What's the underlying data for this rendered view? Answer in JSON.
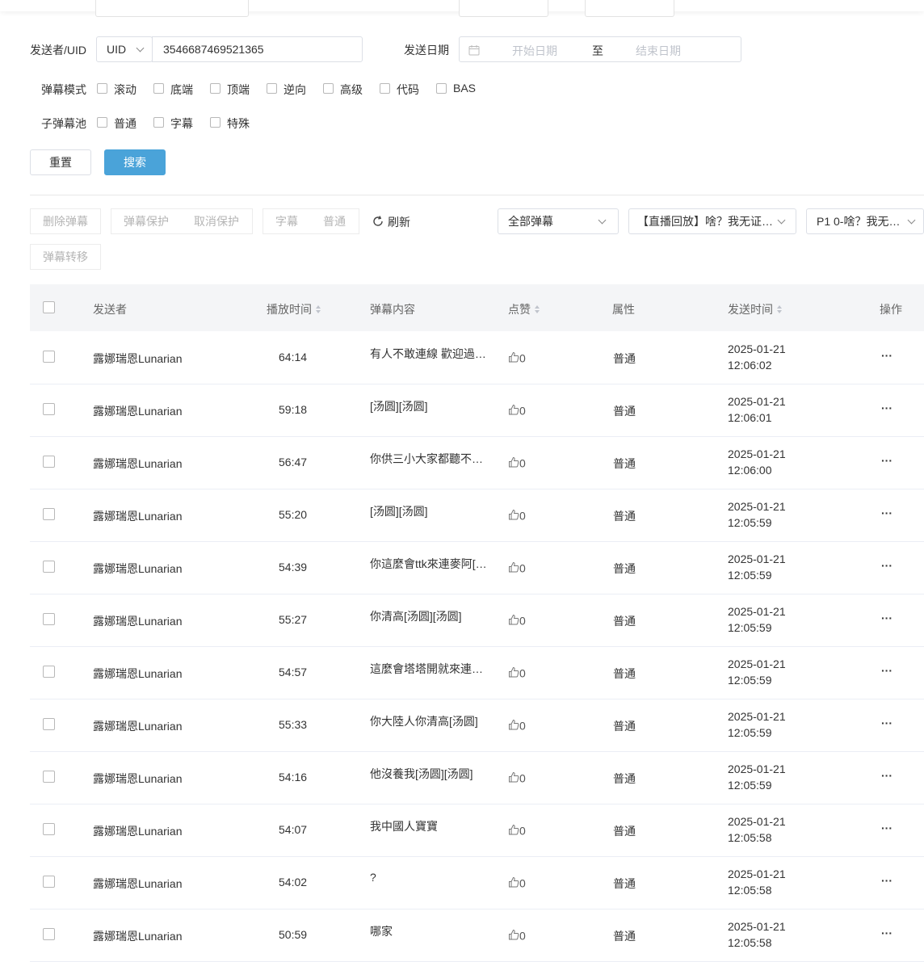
{
  "filters": {
    "sender_label": "发送者/UID",
    "sender_type": "UID",
    "uid_value": "3546687469521365",
    "date_label": "发送日期",
    "start_placeholder": "开始日期",
    "date_separator": "至",
    "end_placeholder": "结束日期",
    "mode_label": "弹幕模式",
    "modes": [
      "滚动",
      "底端",
      "顶端",
      "逆向",
      "高级",
      "代码",
      "BAS"
    ],
    "pool_label": "子弹幕池",
    "pools": [
      "普通",
      "字幕",
      "特殊"
    ],
    "reset_label": "重置",
    "search_label": "搜索"
  },
  "toolbar": {
    "delete_label": "删除弹幕",
    "protect_label": "弹幕保护",
    "unprotect_label": "取消保护",
    "subtitle_label": "字幕",
    "normal_label": "普通",
    "refresh_label": "刷新",
    "transfer_label": "弹幕转移",
    "filter_select": "全部弹幕",
    "video_select": "【直播回放】啥？我无证…",
    "part_select": "P1 0-啥？我无…"
  },
  "table": {
    "headers": {
      "sender": "发送者",
      "playtime": "播放时间",
      "content": "弹幕内容",
      "likes": "点赞",
      "attr": "属性",
      "sendtime": "发送时间",
      "action": "操作"
    },
    "rows": [
      {
        "sender": "露娜瑞恩Lunarian",
        "playtime": "64:14",
        "content": "有人不敢連線 歡迎過…",
        "likes": "0",
        "attr": "普通",
        "date": "2025-01-21",
        "time": "12:06:02"
      },
      {
        "sender": "露娜瑞恩Lunarian",
        "playtime": "59:18",
        "content": "[汤圆][汤圆]",
        "likes": "0",
        "attr": "普通",
        "date": "2025-01-21",
        "time": "12:06:01"
      },
      {
        "sender": "露娜瑞恩Lunarian",
        "playtime": "56:47",
        "content": "你供三小大家都聽不…",
        "likes": "0",
        "attr": "普通",
        "date": "2025-01-21",
        "time": "12:06:00"
      },
      {
        "sender": "露娜瑞恩Lunarian",
        "playtime": "55:20",
        "content": "[汤圆][汤圆]",
        "likes": "0",
        "attr": "普通",
        "date": "2025-01-21",
        "time": "12:05:59"
      },
      {
        "sender": "露娜瑞恩Lunarian",
        "playtime": "54:39",
        "content": "你這麼會ttk來連麥阿[…",
        "likes": "0",
        "attr": "普通",
        "date": "2025-01-21",
        "time": "12:05:59"
      },
      {
        "sender": "露娜瑞恩Lunarian",
        "playtime": "55:27",
        "content": "你清高[汤圆][汤圆]",
        "likes": "0",
        "attr": "普通",
        "date": "2025-01-21",
        "time": "12:05:59"
      },
      {
        "sender": "露娜瑞恩Lunarian",
        "playtime": "54:57",
        "content": "這麼會塔塔開就來連…",
        "likes": "0",
        "attr": "普通",
        "date": "2025-01-21",
        "time": "12:05:59"
      },
      {
        "sender": "露娜瑞恩Lunarian",
        "playtime": "55:33",
        "content": "你大陸人你清高[汤圆]",
        "likes": "0",
        "attr": "普通",
        "date": "2025-01-21",
        "time": "12:05:59"
      },
      {
        "sender": "露娜瑞恩Lunarian",
        "playtime": "54:16",
        "content": "他沒養我[汤圆][汤圆]",
        "likes": "0",
        "attr": "普通",
        "date": "2025-01-21",
        "time": "12:05:59"
      },
      {
        "sender": "露娜瑞恩Lunarian",
        "playtime": "54:07",
        "content": "我中國人寶寶",
        "likes": "0",
        "attr": "普通",
        "date": "2025-01-21",
        "time": "12:05:58"
      },
      {
        "sender": "露娜瑞恩Lunarian",
        "playtime": "54:02",
        "content": "?",
        "likes": "0",
        "attr": "普通",
        "date": "2025-01-21",
        "time": "12:05:58"
      },
      {
        "sender": "露娜瑞恩Lunarian",
        "playtime": "50:59",
        "content": "哪家",
        "likes": "0",
        "attr": "普通",
        "date": "2025-01-21",
        "time": "12:05:58"
      }
    ],
    "action_glyph": "···"
  },
  "icons": {
    "calendar": "calendar-icon",
    "refresh": "refresh-icon",
    "thumb": "thumbs-up-icon",
    "more": "more-icon",
    "chevron": "chevron-down-icon"
  },
  "colors": {
    "primary": "#4aa3d9",
    "header_bg": "#f4f5f7",
    "border": "#dcdfe6"
  }
}
